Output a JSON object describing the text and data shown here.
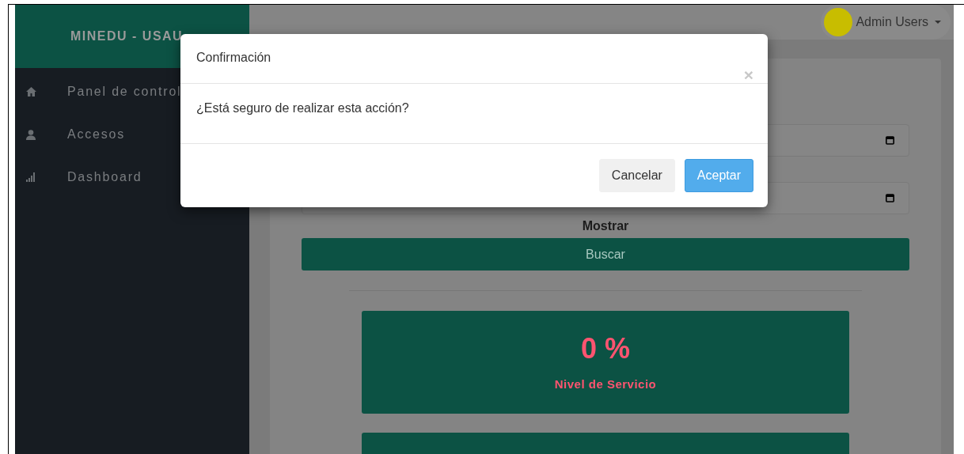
{
  "sidebar": {
    "brand": "MINEDU - USAU",
    "items": [
      {
        "label": "Panel de control"
      },
      {
        "label": "Accesos"
      },
      {
        "label": "Dashboard"
      }
    ]
  },
  "header": {
    "user": "Admin Users"
  },
  "filters": {
    "fields": [
      {
        "kind": "date"
      },
      {
        "kind": "date"
      }
    ],
    "label": "Mostrar",
    "button": "Buscar"
  },
  "cards": [
    {
      "kind": "stat",
      "value": "0 %",
      "caption": "Nivel de Servicio"
    },
    {
      "kind": "blank"
    }
  ],
  "modal": {
    "title": "Confirmación",
    "close": "×",
    "message": "¿Está seguro de realizar esta acción?",
    "buttons": [
      {
        "label": "Cancelar",
        "kind": "secondary"
      },
      {
        "label": "Aceptar",
        "kind": "primary"
      }
    ]
  }
}
